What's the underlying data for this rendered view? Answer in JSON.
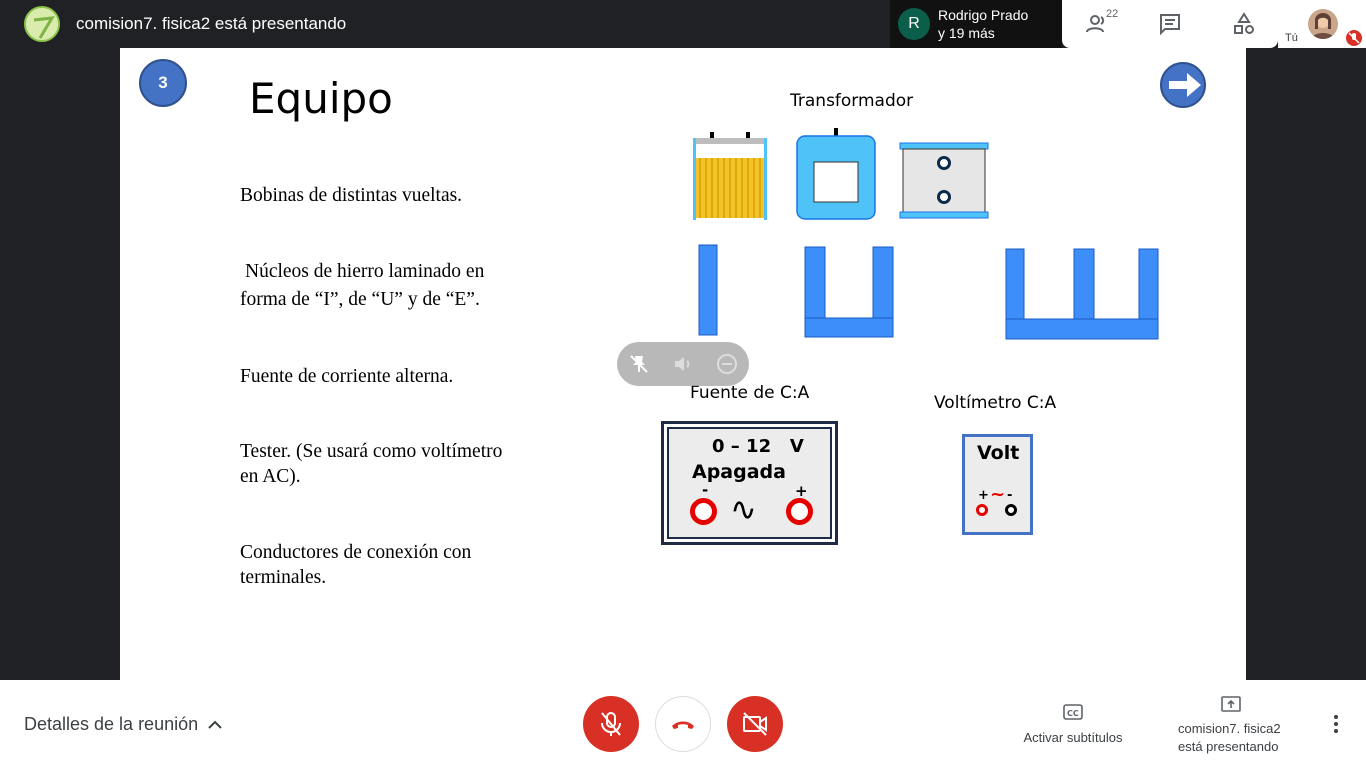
{
  "top": {
    "title": "comision7. fisica2 está presentando",
    "presenter_initial": "R",
    "presenter_line1": "Rodrigo Prado",
    "presenter_line2": "y 19 más",
    "participants_count": "22",
    "you_label": "Tú"
  },
  "slide": {
    "number": "3",
    "title": "Equipo",
    "items": [
      "Bobinas de distintas vueltas.",
      "Núcleos de hierro laminado en",
      "forma de “I”, de “U” y de “E”.",
      "Fuente de corriente alterna.",
      "Tester. (Se usará como voltímetro",
      "en AC).",
      "Conductores de conexión con",
      "terminales."
    ],
    "transformer_label": "Transformador",
    "source_label": "Fuente de C:A",
    "voltmeter_label": "Voltímetro C:A",
    "source_range": "0 – 12   V",
    "source_state": "Apagada",
    "source_minus": "-",
    "source_plus": "+",
    "source_wave": "∿",
    "volt_text": "Volt",
    "volt_plus": "+",
    "volt_tilde": "~",
    "volt_minus": "-"
  },
  "bottom": {
    "details_label": "Detalles de la reunión",
    "captions_label": "Activar subtítulos",
    "present_label_1": "comision7. fisica2",
    "present_label_2": "está presentando"
  },
  "colors": {
    "accent_blue": "#4472c4",
    "shape_blue": "#3d8ef8",
    "light_blue": "#4fc3f7",
    "danger_red": "#d93025",
    "terminal_red": "#e60000"
  },
  "icons": [
    "people-icon",
    "chat-icon",
    "activities-icon",
    "mic-off-icon",
    "hangup-icon",
    "camera-off-icon",
    "captions-icon",
    "present-icon",
    "more-vert-icon",
    "chevron-up-icon",
    "arrow-right-icon"
  ]
}
